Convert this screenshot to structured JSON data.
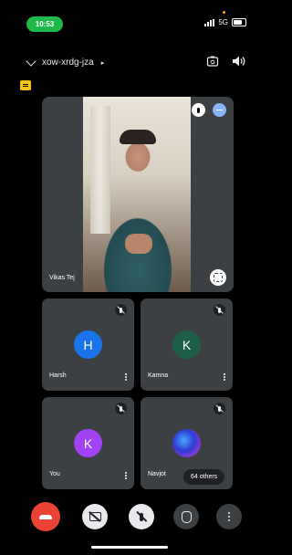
{
  "status_bar": {
    "time": "10:53",
    "network": "5G"
  },
  "meeting": {
    "code": "xow-xrdg-jza",
    "code_suffix": "▸"
  },
  "main_tile": {
    "name": "Vikas Tej"
  },
  "participants": [
    {
      "name": "Harsh",
      "initial": "H",
      "color": "#1a73e8"
    },
    {
      "name": "Kamna",
      "initial": "K",
      "color": "#1e5f4a"
    },
    {
      "name": "You",
      "initial": "K",
      "color": "#a142f4"
    },
    {
      "name": "Navjot",
      "initial": "",
      "others": "64 others"
    }
  ],
  "icons": {
    "back": "chevron-down-icon",
    "switch_camera": "switch-camera-icon",
    "speaker": "speaker-icon",
    "end_call": "end-call-icon",
    "camera": "camera-off-icon",
    "mic": "mic-off-icon",
    "raise_hand": "hand-icon",
    "more": "more-vertical-icon"
  }
}
